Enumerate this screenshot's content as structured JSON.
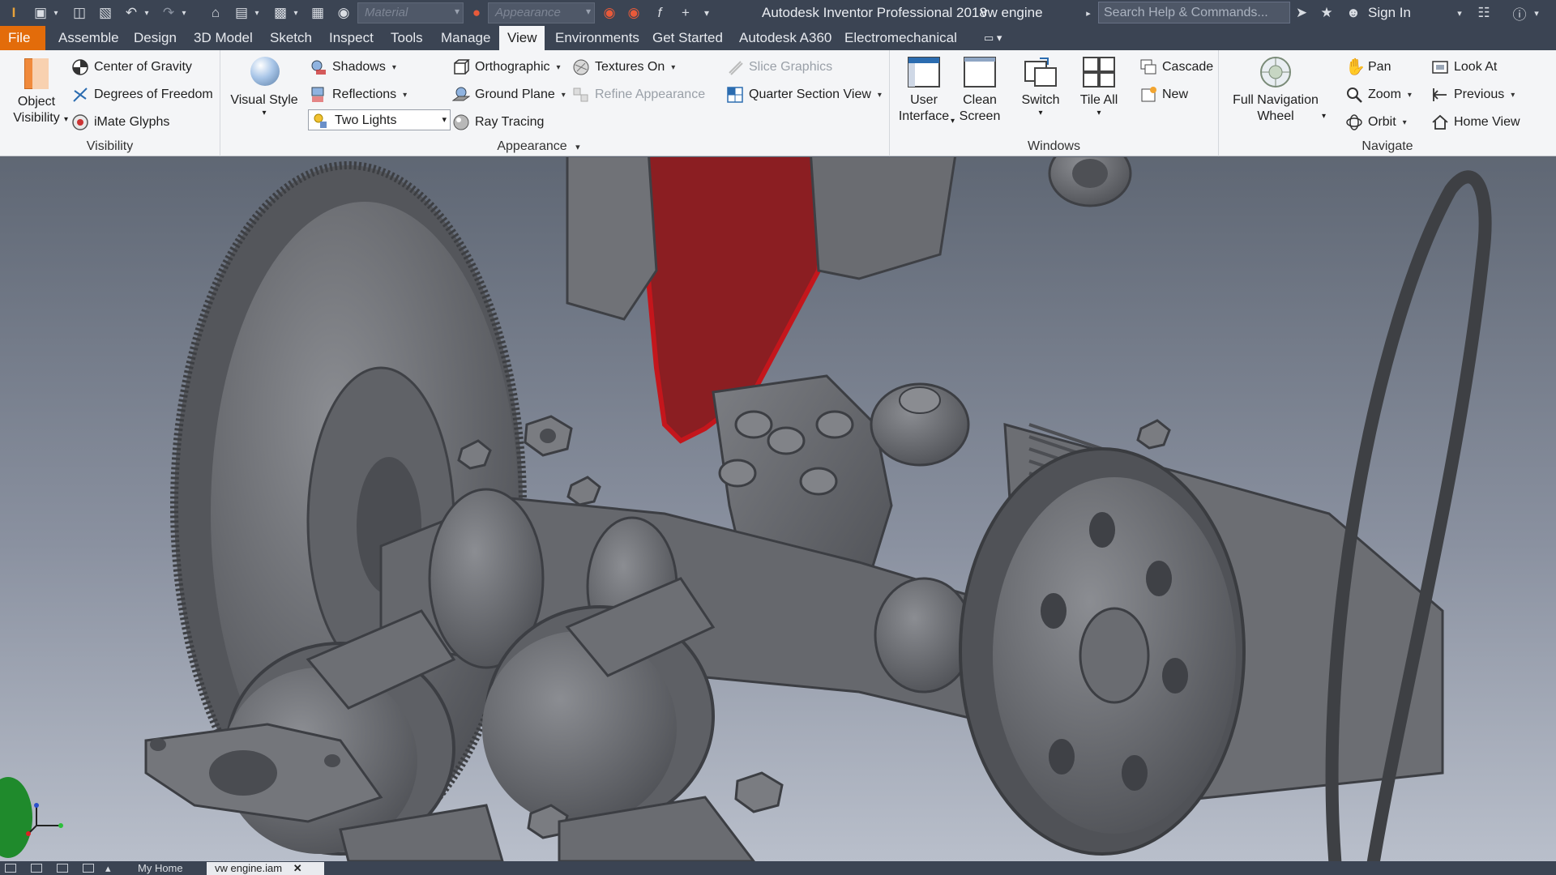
{
  "titlebar": {
    "app_title": "Autodesk Inventor Professional 2018",
    "document_name": "vw engine",
    "material_placeholder": "Material",
    "appearance_placeholder": "Appearance",
    "search_placeholder": "Search Help & Commands...",
    "sign_in": "Sign In"
  },
  "tabs": [
    {
      "label": "File"
    },
    {
      "label": "Assemble"
    },
    {
      "label": "Design"
    },
    {
      "label": "3D Model"
    },
    {
      "label": "Sketch"
    },
    {
      "label": "Inspect"
    },
    {
      "label": "Tools"
    },
    {
      "label": "Manage"
    },
    {
      "label": "View"
    },
    {
      "label": "Environments"
    },
    {
      "label": "Get Started"
    },
    {
      "label": "Autodesk A360"
    },
    {
      "label": "Electromechanical"
    }
  ],
  "ribbon": {
    "visibility": {
      "label": "Visibility",
      "object_visibility": "Object Visibility",
      "center_of_gravity": "Center of Gravity",
      "degrees_of_freedom": "Degrees of Freedom",
      "imate_glyphs": "iMate Glyphs"
    },
    "appearance": {
      "label": "Appearance",
      "visual_style": "Visual Style",
      "shadows": "Shadows",
      "reflections": "Reflections",
      "lighting": "Two Lights",
      "orthographic": "Orthographic",
      "ground_plane": "Ground Plane",
      "ray_tracing": "Ray Tracing",
      "textures_on": "Textures On",
      "refine_appearance": "Refine Appearance",
      "slice_graphics": "Slice Graphics",
      "quarter_section_view": "Quarter Section View"
    },
    "windows": {
      "label": "Windows",
      "user_interface": "User Interface",
      "clean_screen": "Clean Screen",
      "switch": "Switch",
      "tile_all": "Tile All",
      "cascade": "Cascade",
      "new": "New"
    },
    "navigate": {
      "label": "Navigate",
      "full_navigation_wheel": "Full Navigation Wheel",
      "pan": "Pan",
      "zoom": "Zoom",
      "orbit": "Orbit",
      "look_at": "Look At",
      "previous": "Previous",
      "home_view": "Home View"
    }
  },
  "bottom_tabs": [
    {
      "label": "My Home"
    },
    {
      "label": "vw engine.iam"
    }
  ],
  "colors": {
    "title_bar": "#3b4453",
    "file_tab": "#e36c0a",
    "ribbon_bg": "#f4f5f7",
    "part_gray": "#6b6d72",
    "highlight_red": "#b3181c"
  }
}
